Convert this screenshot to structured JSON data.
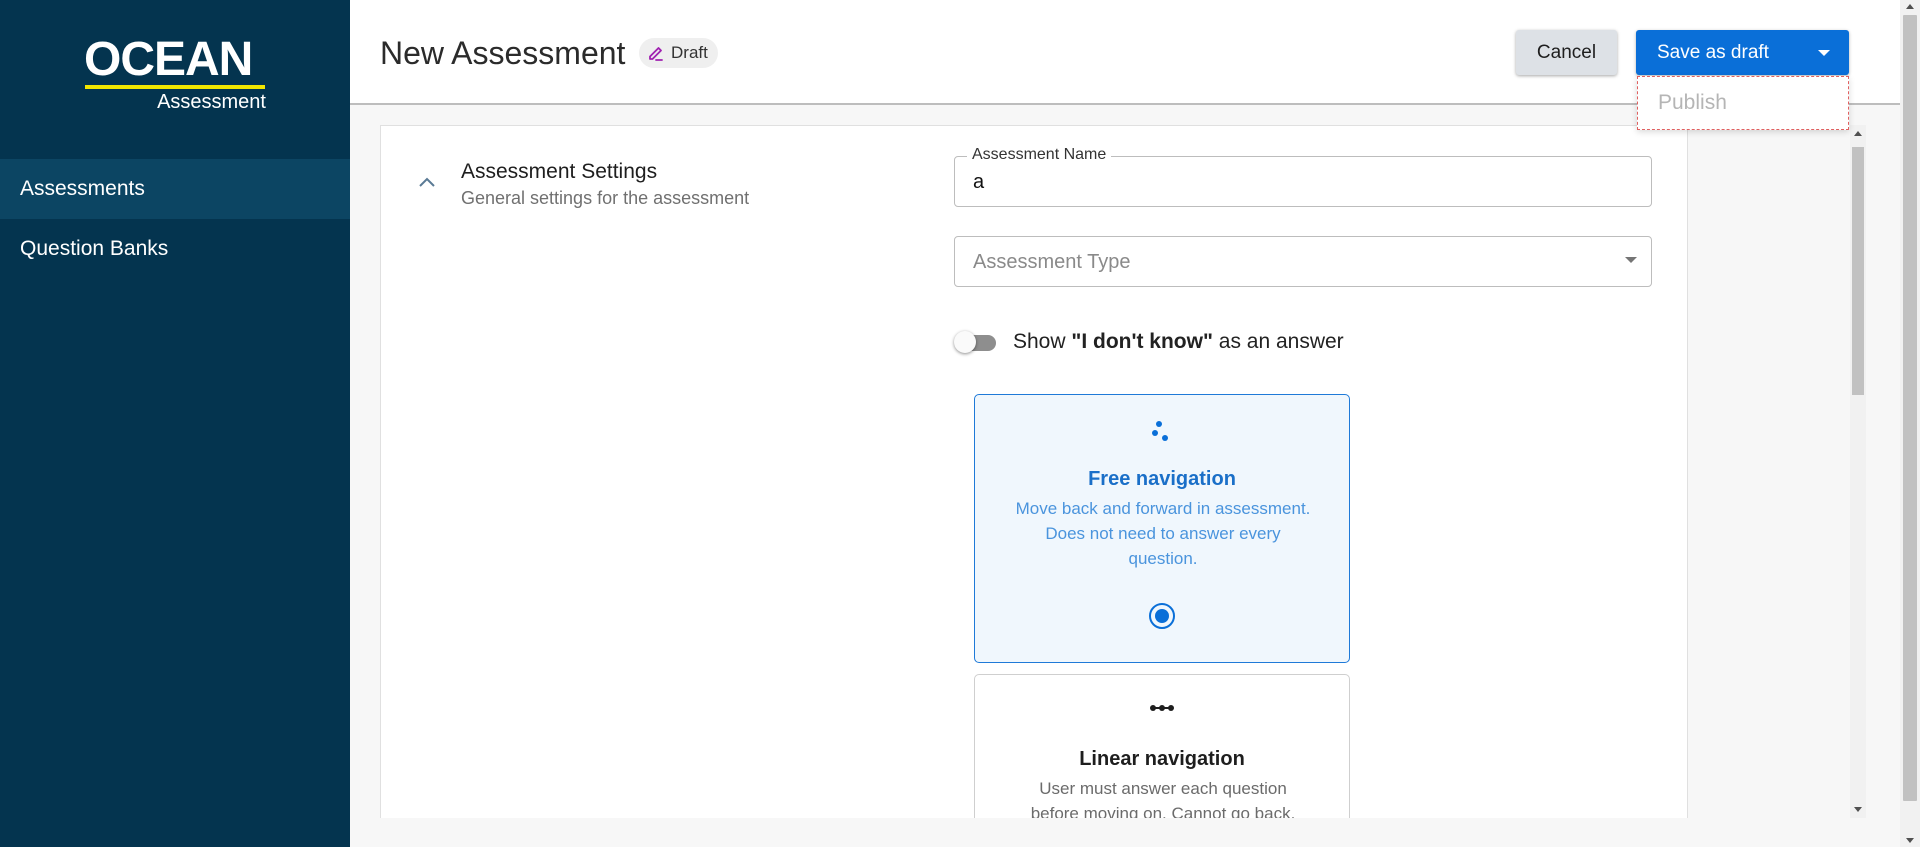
{
  "brand": {
    "name": "OCEAN",
    "subtitle": "Assessment",
    "accent_color": "#f2e600",
    "sidebar_color": "#04344f"
  },
  "sidebar": {
    "items": [
      {
        "label": "Assessments",
        "active": true
      },
      {
        "label": "Question Banks",
        "active": false
      }
    ]
  },
  "header": {
    "title": "New Assessment",
    "status_badge": "Draft",
    "cancel_label": "Cancel",
    "save_label": "Save as draft",
    "primary_color": "#0a6fd8"
  },
  "save_menu": {
    "items": [
      "Publish"
    ]
  },
  "settings": {
    "title": "Assessment Settings",
    "subtitle": "General settings for the assessment",
    "name_field": {
      "label": "Assessment Name",
      "value": "a"
    },
    "type_field": {
      "placeholder": "Assessment Type"
    },
    "dont_know_toggle": {
      "prefix": "Show ",
      "bold": "\"I don't know\"",
      "suffix": " as an answer",
      "checked": false
    },
    "navigation_options": [
      {
        "title": "Free navigation",
        "description": "Move back and forward in assessment. Does not need to answer every question.",
        "selected": true,
        "icon": "scatter-dots-icon"
      },
      {
        "title": "Linear navigation",
        "description": "User must answer each question before moving on. Cannot go back.",
        "selected": false,
        "icon": "linear-dots-icon"
      }
    ]
  }
}
